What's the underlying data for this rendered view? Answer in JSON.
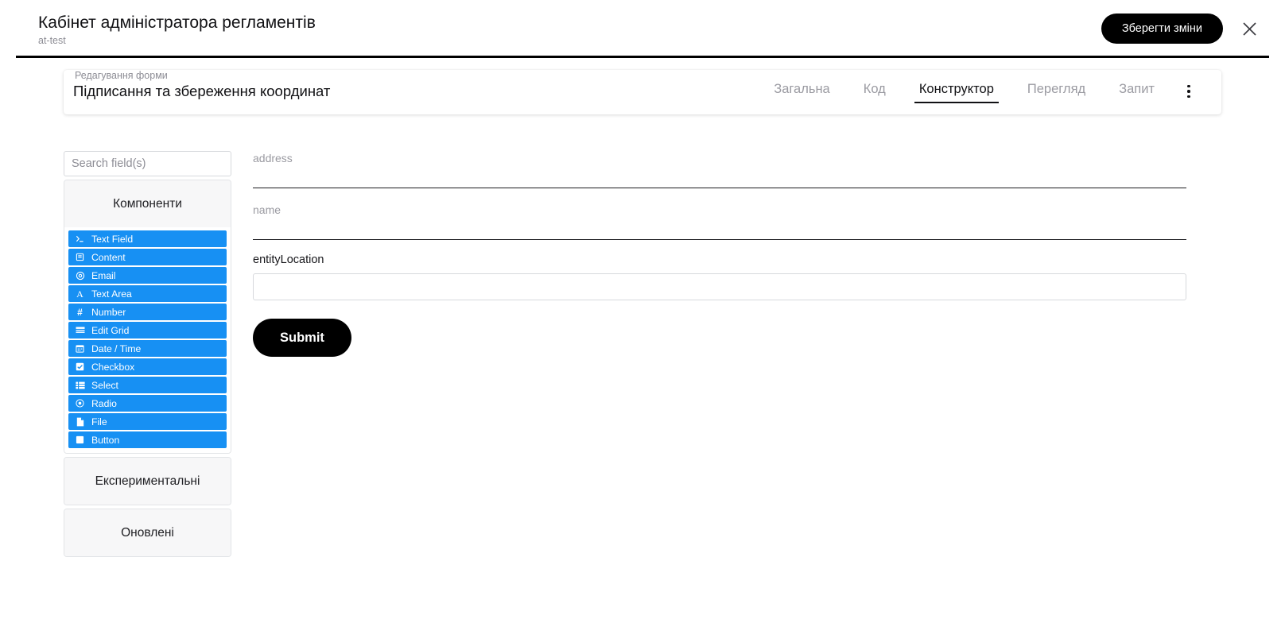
{
  "header": {
    "title": "Кабінет адміністратора регламентів",
    "subtitle": "at-test",
    "save_label": "Зберегти зміни",
    "close_icon": "close-icon"
  },
  "form_card": {
    "section_label": "Редагування форми",
    "form_name": "Підписання та збереження координат",
    "tabs": [
      {
        "label": "Загальна",
        "active": false
      },
      {
        "label": "Код",
        "active": false
      },
      {
        "label": "Конструктор",
        "active": true
      },
      {
        "label": "Перегляд",
        "active": false
      },
      {
        "label": "Запит",
        "active": false
      }
    ],
    "kebab_icon": "more-vertical-icon"
  },
  "sidebar": {
    "search_placeholder": "Search field(s)",
    "search_value": "",
    "groups": [
      {
        "title": "Компоненти",
        "expanded": true,
        "items": [
          {
            "label": "Text Field",
            "icon": "terminal-icon"
          },
          {
            "label": "Content",
            "icon": "content-icon"
          },
          {
            "label": "Email",
            "icon": "at-icon"
          },
          {
            "label": "Text Area",
            "icon": "font-icon"
          },
          {
            "label": "Number",
            "icon": "hash-icon"
          },
          {
            "label": "Edit Grid",
            "icon": "list-alt-icon"
          },
          {
            "label": "Date / Time",
            "icon": "calendar-icon"
          },
          {
            "label": "Checkbox",
            "icon": "checkbox-icon"
          },
          {
            "label": "Select",
            "icon": "th-list-icon"
          },
          {
            "label": "Radio",
            "icon": "radio-icon"
          },
          {
            "label": "File",
            "icon": "file-icon"
          },
          {
            "label": "Button",
            "icon": "square-icon"
          }
        ]
      },
      {
        "title": "Експериментальні",
        "expanded": false,
        "items": []
      },
      {
        "title": "Оновлені",
        "expanded": false,
        "items": []
      }
    ]
  },
  "form": {
    "fields": [
      {
        "key": "address",
        "label": "address",
        "style": "underline",
        "value": ""
      },
      {
        "key": "name",
        "label": "name",
        "style": "underline",
        "value": ""
      },
      {
        "key": "entityLocation",
        "label": "entityLocation",
        "style": "boxed",
        "value": ""
      }
    ],
    "submit_label": "Submit"
  },
  "colors": {
    "accent_blue": "#1790f3",
    "button_black": "#000000",
    "muted_text": "#9b9ba2",
    "panel_grey": "#f7f7f8"
  }
}
